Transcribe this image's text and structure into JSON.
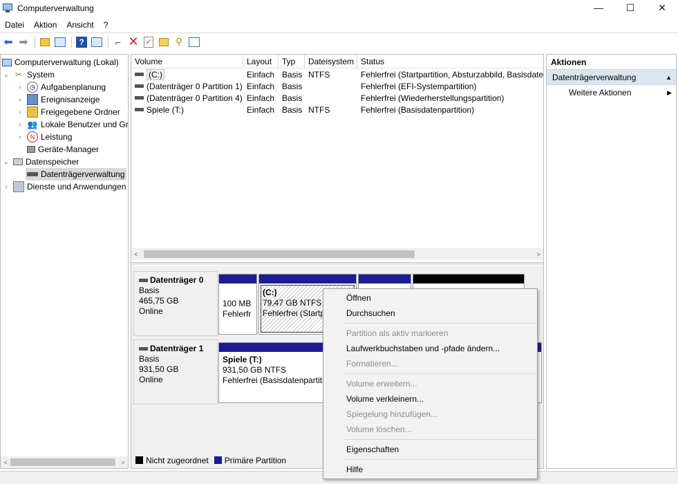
{
  "window": {
    "title": "Computerverwaltung",
    "minimize": "—",
    "maximize": "☐",
    "close": "✕"
  },
  "menu": [
    "Datei",
    "Aktion",
    "Ansicht",
    "?"
  ],
  "tree": {
    "root": "Computerverwaltung (Lokal)",
    "system": "System",
    "aufgabenplanung": "Aufgabenplanung",
    "ereignisanzeige": "Ereignisanzeige",
    "freigegebene": "Freigegebene Ordner",
    "benutzer": "Lokale Benutzer und Gr",
    "leistung": "Leistung",
    "geraete": "Geräte-Manager",
    "datenspeicher": "Datenspeicher",
    "datentraeger": "Datenträgerverwaltung",
    "dienste": "Dienste und Anwendungen"
  },
  "volumes": {
    "headers": [
      "Volume",
      "Layout",
      "Typ",
      "Dateisystem",
      "Status"
    ],
    "rows": [
      {
        "volume": "(C:)",
        "layout": "Einfach",
        "typ": "Basis",
        "fs": "NTFS",
        "status": "Fehlerfrei (Startpartition, Absturzabbild, Basisdater"
      },
      {
        "volume": "(Datenträger 0 Partition 1)",
        "layout": "Einfach",
        "typ": "Basis",
        "fs": "",
        "status": "Fehlerfrei (EFI-Systempartition)"
      },
      {
        "volume": "(Datenträger 0 Partition 4)",
        "layout": "Einfach",
        "typ": "Basis",
        "fs": "",
        "status": "Fehlerfrei (Wiederherstellungspartition)"
      },
      {
        "volume": "Spiele (T:)",
        "layout": "Einfach",
        "typ": "Basis",
        "fs": "NTFS",
        "status": "Fehlerfrei (Basisdatenpartition)"
      }
    ]
  },
  "disks": {
    "d0": {
      "name": "Datenträger 0",
      "type": "Basis",
      "size": "465,75 GB",
      "state": "Online",
      "p1_size": "100 MB",
      "p1_status": "Fehlerfr",
      "p2_name": "(C:)",
      "p2_size": "79,47 GB NTFS",
      "p2_status": "Fehlerfrei (Startp"
    },
    "d1": {
      "name": "Datenträger 1",
      "type": "Basis",
      "size": "931,50 GB",
      "state": "Online",
      "p1_name": "Spiele  (T:)",
      "p1_size": "931,50 GB NTFS",
      "p1_status": "Fehlerfrei (Basisdatenpartiti"
    }
  },
  "legend": {
    "unallocated": "Nicht zugeordnet",
    "primary": "Primäre Partition",
    "unallocated_color": "#000000",
    "primary_color": "#1c1c96"
  },
  "actions": {
    "header": "Aktionen",
    "section": "Datenträgerverwaltung",
    "more": "Weitere Aktionen"
  },
  "context_menu": {
    "open": "Öffnen",
    "browse": "Durchsuchen",
    "mark_active": "Partition als aktiv markieren",
    "change_letter": "Laufwerkbuchstaben und -pfade ändern...",
    "format": "Formatieren...",
    "extend": "Volume erweitern...",
    "shrink": "Volume verkleinern...",
    "mirror": "Spiegelung hinzufügen...",
    "delete": "Volume löschen...",
    "properties": "Eigenschaften",
    "help": "Hilfe"
  }
}
